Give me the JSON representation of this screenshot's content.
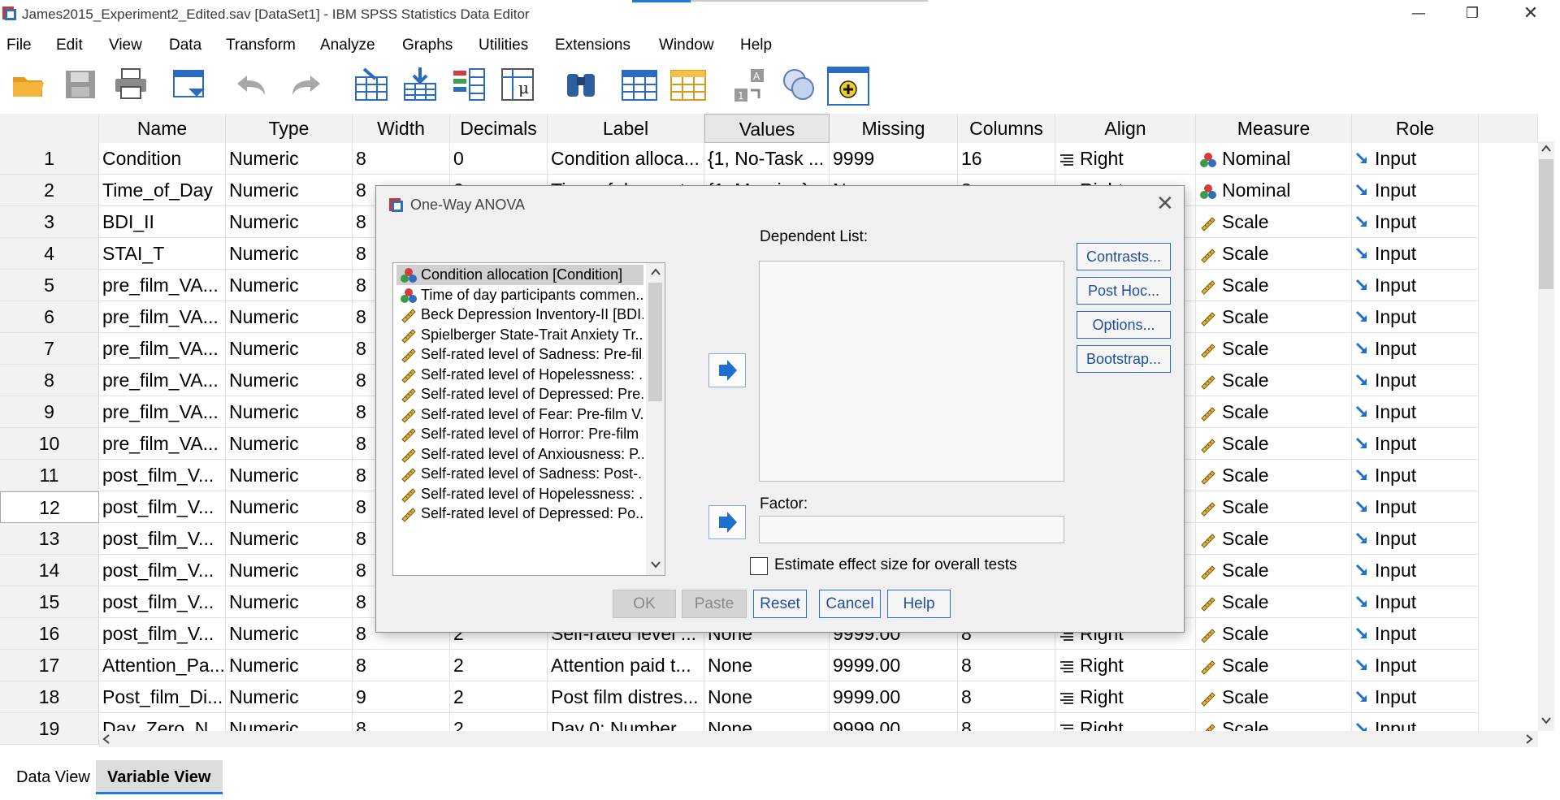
{
  "window": {
    "title": "James2015_Experiment2_Edited.sav [DataSet1] - IBM SPSS Statistics Data Editor",
    "controls": [
      "—",
      "❐",
      "✕"
    ]
  },
  "menu": [
    "File",
    "Edit",
    "View",
    "Data",
    "Transform",
    "Analyze",
    "Graphs",
    "Utilities",
    "Extensions",
    "Window",
    "Help"
  ],
  "toolbar_icons": [
    "open-folder-icon",
    "save-icon",
    "print-icon",
    "dialog-recall-icon",
    "undo-icon",
    "redo-icon",
    "goto-case-icon",
    "goto-variable-icon",
    "variables-icon",
    "run-descriptives-icon",
    "find-icon",
    "insert-cases-icon",
    "insert-variable-icon",
    "split-file-icon",
    "select-cases-icon",
    "custom-dialog-icon"
  ],
  "columns": [
    "Name",
    "Type",
    "Width",
    "Decimals",
    "Label",
    "Values",
    "Missing",
    "Columns",
    "Align",
    "Measure",
    "Role"
  ],
  "rows": [
    [
      "1",
      "Condition",
      "Numeric",
      "8",
      "0",
      "Condition alloca...",
      "{1, No-Task ...",
      "9999",
      "16",
      "Right",
      "Nominal",
      "Input"
    ],
    [
      "2",
      "Time_of_Day",
      "Numeric",
      "8",
      "0",
      "Time of day part...",
      "{1, Morning}...",
      "None",
      "8",
      "Right",
      "Nominal",
      "Input"
    ],
    [
      "3",
      "BDI_II",
      "Numeric",
      "8",
      "",
      "",
      "",
      "",
      "",
      "",
      "Scale",
      "Input"
    ],
    [
      "4",
      "STAI_T",
      "Numeric",
      "8",
      "",
      "",
      "",
      "",
      "",
      "",
      "Scale",
      "Input"
    ],
    [
      "5",
      "pre_film_VA...",
      "Numeric",
      "8",
      "",
      "",
      "",
      "",
      "",
      "",
      "Scale",
      "Input"
    ],
    [
      "6",
      "pre_film_VA...",
      "Numeric",
      "8",
      "",
      "",
      "",
      "",
      "",
      "",
      "Scale",
      "Input"
    ],
    [
      "7",
      "pre_film_VA...",
      "Numeric",
      "8",
      "",
      "",
      "",
      "",
      "",
      "",
      "Scale",
      "Input"
    ],
    [
      "8",
      "pre_film_VA...",
      "Numeric",
      "8",
      "",
      "",
      "",
      "",
      "",
      "",
      "Scale",
      "Input"
    ],
    [
      "9",
      "pre_film_VA...",
      "Numeric",
      "8",
      "",
      "",
      "",
      "",
      "",
      "",
      "Scale",
      "Input"
    ],
    [
      "10",
      "pre_film_VA...",
      "Numeric",
      "8",
      "",
      "",
      "",
      "",
      "",
      "",
      "Scale",
      "Input"
    ],
    [
      "11",
      "post_film_V...",
      "Numeric",
      "8",
      "",
      "",
      "",
      "",
      "",
      "",
      "Scale",
      "Input"
    ],
    [
      "12",
      "post_film_V...",
      "Numeric",
      "8",
      "",
      "",
      "",
      "",
      "",
      "",
      "Scale",
      "Input"
    ],
    [
      "13",
      "post_film_V...",
      "Numeric",
      "8",
      "",
      "",
      "",
      "",
      "",
      "",
      "Scale",
      "Input"
    ],
    [
      "14",
      "post_film_V...",
      "Numeric",
      "8",
      "",
      "",
      "",
      "",
      "",
      "",
      "Scale",
      "Input"
    ],
    [
      "15",
      "post_film_V...",
      "Numeric",
      "8",
      "",
      "",
      "",
      "",
      "",
      "",
      "Scale",
      "Input"
    ],
    [
      "16",
      "post_film_V...",
      "Numeric",
      "8",
      "2",
      "Self-rated level ...",
      "None",
      "9999.00",
      "8",
      "Right",
      "Scale",
      "Input"
    ],
    [
      "17",
      "Attention_Pa...",
      "Numeric",
      "8",
      "2",
      "Attention paid t...",
      "None",
      "9999.00",
      "8",
      "Right",
      "Scale",
      "Input"
    ],
    [
      "18",
      "Post_film_Di...",
      "Numeric",
      "9",
      "2",
      "Post film distres...",
      "None",
      "9999.00",
      "8",
      "Right",
      "Scale",
      "Input"
    ],
    [
      "19",
      "Day_Zero_N...",
      "Numeric",
      "8",
      "2",
      "Day 0: Number ...",
      "None",
      "9999.00",
      "8",
      "Right",
      "Scale",
      "Input"
    ]
  ],
  "tabs": [
    "Data View",
    "Variable View"
  ],
  "dialog": {
    "title": "One-Way ANOVA",
    "close": "✕",
    "variables": [
      {
        "label": "Condition allocation [Condition]",
        "measure": "nominal"
      },
      {
        "label": "Time of day participants commen...",
        "measure": "nominal"
      },
      {
        "label": "Beck Depression Inventory-II [BDI...",
        "measure": "scale"
      },
      {
        "label": "Spielberger State-Trait Anxiety Tr...",
        "measure": "scale"
      },
      {
        "label": "Self-rated level of Sadness: Pre-fil...",
        "measure": "scale"
      },
      {
        "label": "Self-rated level of Hopelessness: ...",
        "measure": "scale"
      },
      {
        "label": "Self-rated level of Depressed: Pre...",
        "measure": "scale"
      },
      {
        "label": "Self-rated level of Fear: Pre-film V...",
        "measure": "scale"
      },
      {
        "label": "Self-rated level of Horror: Pre-film ...",
        "measure": "scale"
      },
      {
        "label": "Self-rated level of Anxiousness: P...",
        "measure": "scale"
      },
      {
        "label": "Self-rated level of Sadness: Post-...",
        "measure": "scale"
      },
      {
        "label": "Self-rated level of Hopelessness: ...",
        "measure": "scale"
      },
      {
        "label": "Self-rated level of Depressed: Po...",
        "measure": "scale"
      }
    ],
    "dependent_label": "Dependent List:",
    "factor_label": "Factor:",
    "side_buttons": [
      "Contrasts...",
      "Post Hoc...",
      "Options...",
      "Bootstrap..."
    ],
    "checkbox_label": "Estimate effect size for overall tests",
    "buttons": [
      "OK",
      "Paste",
      "Reset",
      "Cancel",
      "Help"
    ]
  }
}
